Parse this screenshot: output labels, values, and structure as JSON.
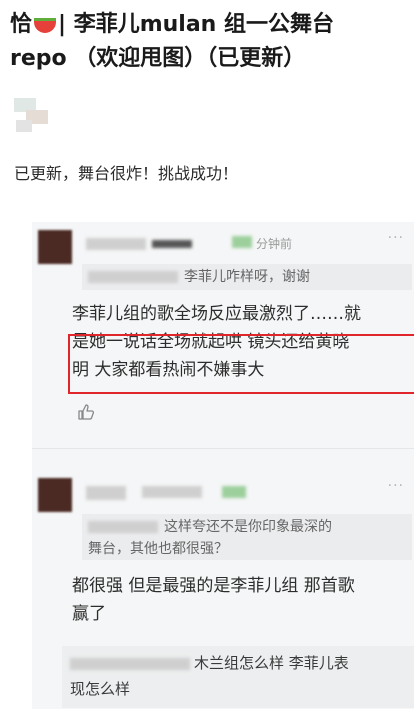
{
  "post": {
    "title_start": "恰",
    "title_rest": "| 李菲儿mulan 组一公舞台",
    "title_line2": "repo （欢迎甩图）（已更新）",
    "body": "已更新，舞台很炸！挑战成功！"
  },
  "comments": [
    {
      "timestamp": "分钟前",
      "quote": "李菲儿咋样呀，谢谢",
      "reply_line1": "李菲儿组的歌全场反应最激烈了……就",
      "reply_line2": "是她一说话全场就起哄 镜头还给黄晓",
      "reply_line3": "明 大家都看热闹不嫌事大"
    },
    {
      "quote_line1": "这样夸还不是你印象最深的",
      "quote_line2": "舞台，其他也都很强？",
      "reply_line1": "都很强 但是最强的是李菲儿组 那首歌",
      "reply_line2": "赢了"
    }
  ],
  "nested_reply": {
    "line1": "木兰组怎么样 李菲儿表",
    "line2": "现怎么样"
  },
  "icons": {
    "more": "more-icon",
    "like": "thumbs-up-icon",
    "fruit": "watermelon-icon"
  },
  "colors": {
    "highlight_border": "#e0262a",
    "comment_bg": "#f5f6f7"
  }
}
